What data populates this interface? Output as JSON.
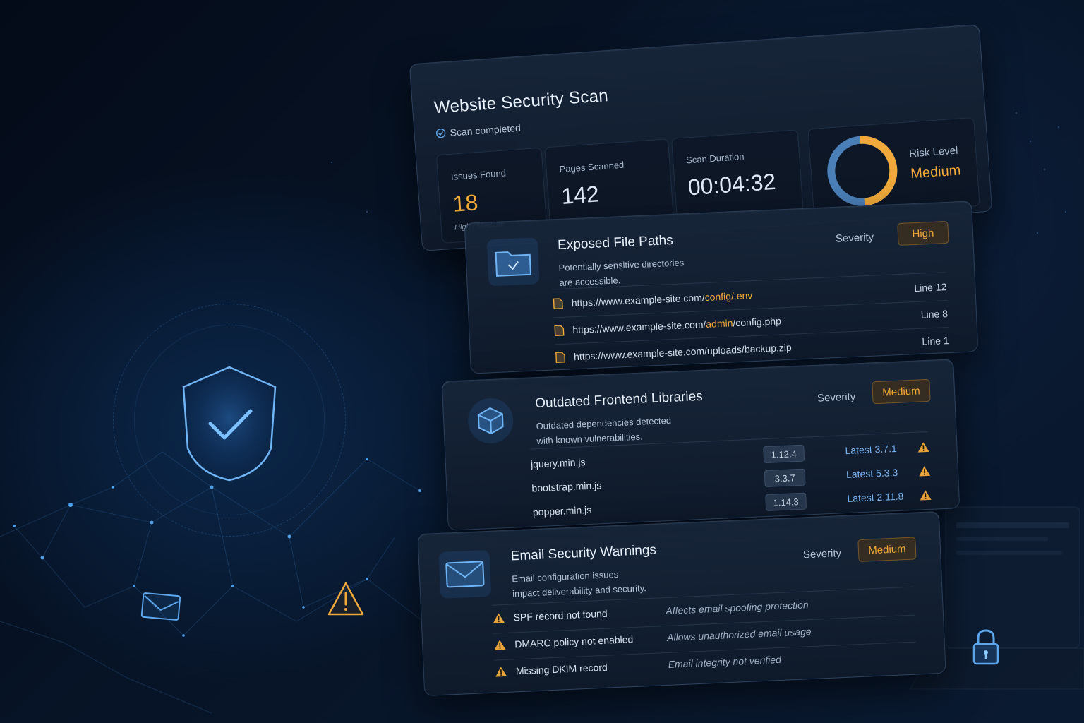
{
  "header": {
    "title": "Website Security Scan",
    "status": "Scan completed",
    "stats": [
      {
        "label": "Issues Found",
        "value": "18",
        "sub": "High / Medium"
      },
      {
        "label": "Pages Scanned",
        "value": "142"
      },
      {
        "label": "Scan Duration",
        "value": "00:04:32"
      }
    ],
    "risk": {
      "label": "Risk Level",
      "value": "Medium",
      "gauge_fraction_orange": 0.5
    }
  },
  "issues": [
    {
      "title": "Exposed File Paths",
      "description_line1": "Potentially sensitive directories",
      "description_line2": "are accessible.",
      "severity_label": "Severity",
      "severity": "High",
      "icon": "folder-icon",
      "rows": [
        {
          "path_prefix": "https://www.example-site.com/",
          "path_highlight": "config/.env",
          "path_suffix": "",
          "line": "Line 12"
        },
        {
          "path_prefix": "https://www.example-site.com/",
          "path_highlight": "admin",
          "path_suffix": "/config.php",
          "line": "Line 8"
        },
        {
          "path_prefix": "https://www.example-site.com/uploads/backup.zip",
          "path_highlight": "",
          "path_suffix": "",
          "line": "Line 1"
        }
      ]
    },
    {
      "title": "Outdated Frontend Libraries",
      "description_line1": "Outdated dependencies detected",
      "description_line2": "with known vulnerabilities.",
      "severity_label": "Severity",
      "severity": "Medium",
      "icon": "package-cube-icon",
      "libraries": [
        {
          "name": "jquery.min.js",
          "version": "1.12.4",
          "latest": "Latest 3.7.1"
        },
        {
          "name": "bootstrap.min.js",
          "version": "3.3.7",
          "latest": "Latest 5.3.3"
        },
        {
          "name": "popper.min.js",
          "version": "1.14.3",
          "latest": "Latest 2.11.8"
        }
      ]
    },
    {
      "title": "Email Security Warnings",
      "description_line1": "Email configuration issues",
      "description_line2": "impact deliverability and security.",
      "severity_label": "Severity",
      "severity": "Medium",
      "icon": "envelope-icon",
      "warnings": [
        {
          "name": "SPF record not found",
          "impact": "Affects email spoofing protection"
        },
        {
          "name": "DMARC policy not enabled",
          "impact": "Allows unauthorized email usage"
        },
        {
          "name": "Missing DKIM record",
          "impact": "Email integrity not verified"
        }
      ]
    }
  ],
  "colors": {
    "accent_orange": "#f0a93a",
    "accent_blue": "#4f8fd6",
    "background": "#071427"
  }
}
